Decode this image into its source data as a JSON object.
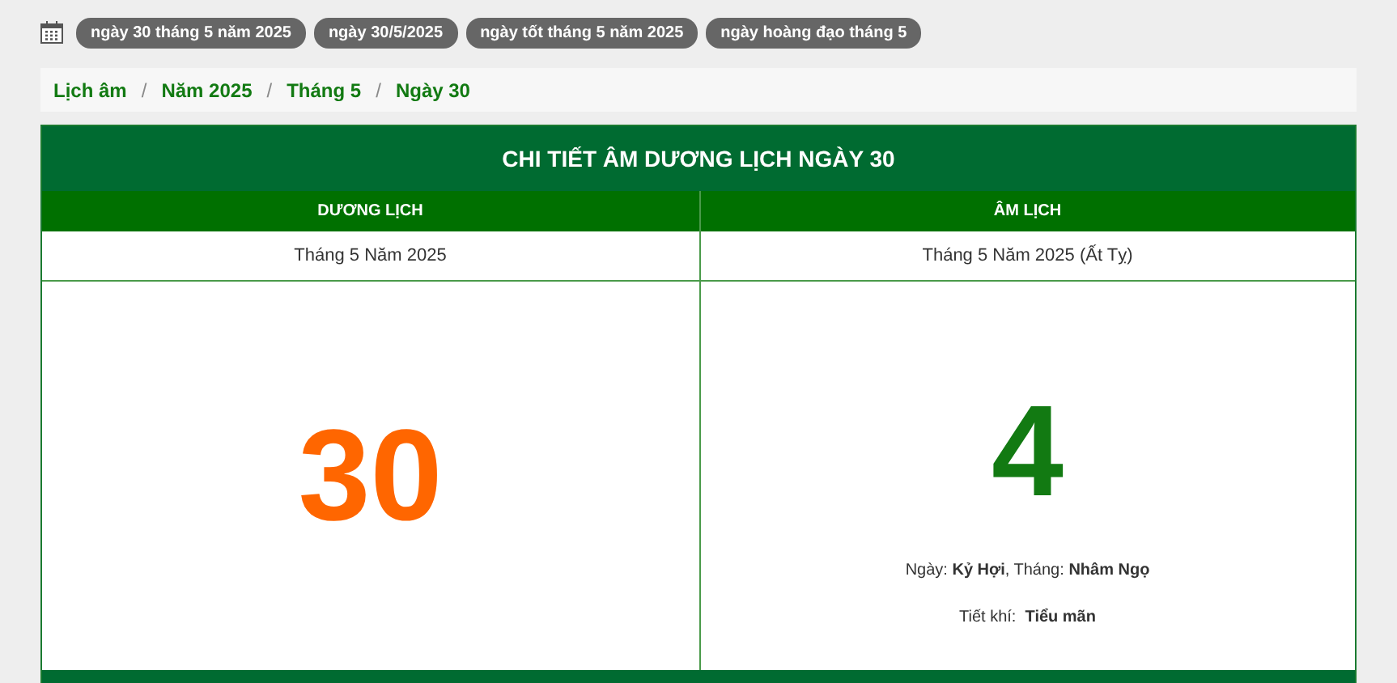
{
  "tags": [
    "ngày 30 tháng 5 năm 2025",
    "ngày 30/5/2025",
    "ngày tốt tháng 5 năm 2025",
    "ngày hoàng đạo tháng 5"
  ],
  "breadcrumb": [
    "Lịch âm",
    "Năm 2025",
    "Tháng 5",
    "Ngày 30"
  ],
  "breadcrumb_separator": "/",
  "table": {
    "title": "CHI TIẾT ÂM DƯƠNG LỊCH NGÀY 30",
    "columns": [
      {
        "heading": "DƯƠNG LỊCH",
        "month": "Tháng 5 Năm 2025",
        "day": "30",
        "kind": "solar"
      },
      {
        "heading": "ÂM LỊCH",
        "month": "Tháng 5 Năm 2025 (Ất Tỵ)",
        "day": "4",
        "kind": "lunar",
        "details": [
          "Ngày: **Kỷ Hợi**, Tháng: **Nhâm Ngọ**",
          "Tiết khí:  **Tiểu mãn**"
        ]
      }
    ]
  }
}
